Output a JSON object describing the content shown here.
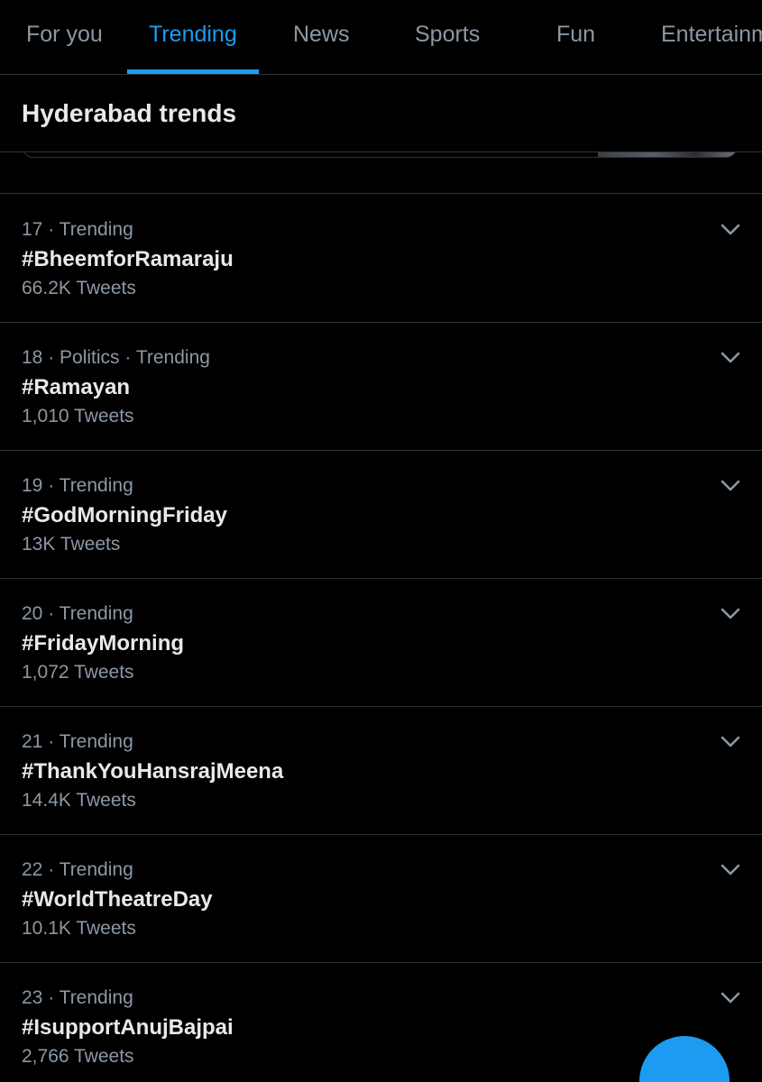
{
  "tabs": [
    {
      "label": "For you"
    },
    {
      "label": "Trending"
    },
    {
      "label": "News"
    },
    {
      "label": "Sports"
    },
    {
      "label": "Fun"
    },
    {
      "label": "Entertainm"
    }
  ],
  "active_tab": "Trending",
  "section": {
    "title": "Hyderabad trends"
  },
  "trends": [
    {
      "meta": "17 · Trending",
      "name": "#BheemforRamaraju",
      "count": "66.2K Tweets"
    },
    {
      "meta": "18 · Politics · Trending",
      "name": "#Ramayan",
      "count": "1,010 Tweets"
    },
    {
      "meta": "19 · Trending",
      "name": "#GodMorningFriday",
      "count": "13K Tweets"
    },
    {
      "meta": "20 · Trending",
      "name": "#FridayMorning",
      "count": "1,072 Tweets"
    },
    {
      "meta": "21 · Trending",
      "name": "#ThankYouHansrajMeena",
      "count": "14.4K Tweets"
    },
    {
      "meta": "22 · Trending",
      "name": "#WorldTheatreDay",
      "count": "10.1K Tweets"
    },
    {
      "meta": "23 · Trending",
      "name": "#IsupportAnujBajpai",
      "count": "2,766 Tweets"
    }
  ],
  "icons": {
    "more": "chevron-down-icon",
    "fab": "compose-icon"
  },
  "colors": {
    "background": "#000000",
    "accent": "#1d9bf0",
    "text_primary": "#e7e9ea",
    "text_secondary": "#8b98a5",
    "divider": "#2f3336"
  }
}
